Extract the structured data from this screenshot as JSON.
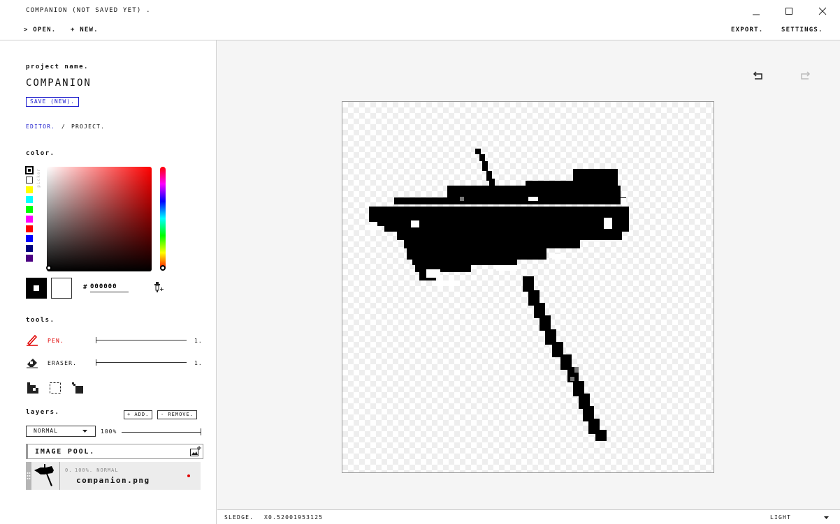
{
  "window": {
    "title": "COMPANION (NOT SAVED YET) .",
    "open_label": "> OPEN.",
    "new_label": "+ NEW.",
    "export_label": "EXPORT.",
    "settings_label": "SETTINGS."
  },
  "project": {
    "heading": "project name.",
    "name": "COMPANION",
    "save_label": "SAVE (NEW).",
    "crumb_editor": "EDITOR.",
    "crumb_sep": "/",
    "crumb_project": "PROJECT."
  },
  "color": {
    "heading": "color.",
    "picker_label": "picker",
    "swatches": [
      "#000000",
      "#ffffff",
      "#ffff00",
      "#00ffff",
      "#00ff00",
      "#ff00ff",
      "#ff0000",
      "#0000ff",
      "#000080",
      "#4b0082"
    ],
    "hash": "#",
    "hex_value": "000000"
  },
  "tools": {
    "heading": "tools.",
    "pen_label": "PEN.",
    "pen_size": "1.",
    "eraser_label": "ERASER.",
    "eraser_size": "1."
  },
  "layers": {
    "heading": "layers.",
    "add_label": "+ ADD.",
    "remove_label": "- REMOVE.",
    "blend_mode": "NORMAL",
    "opacity": "100%",
    "pool_label": "IMAGE POOL.",
    "items": [
      {
        "index": "0.",
        "meta": "100%. NORMAL",
        "name": "companion.png"
      }
    ]
  },
  "status": {
    "tool": "SLEDGE.",
    "zoom": "X0.52001953125",
    "theme": "LIGHT"
  }
}
